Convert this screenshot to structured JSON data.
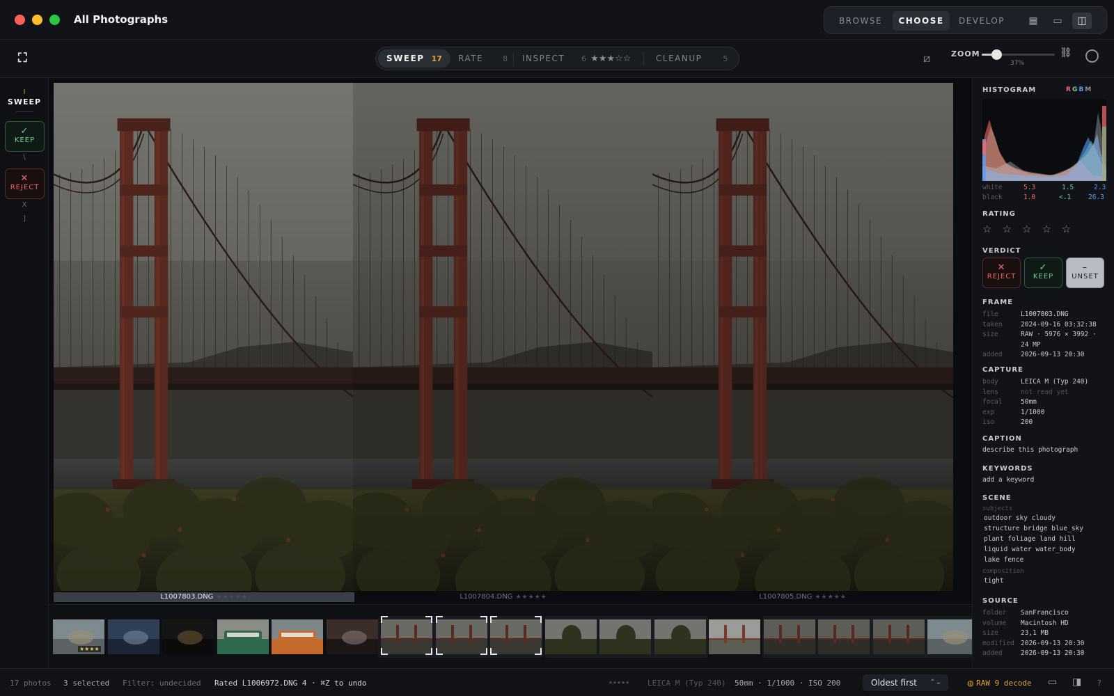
{
  "window": {
    "title": "All Photographs"
  },
  "modes": [
    {
      "label": "BROWSE",
      "active": false
    },
    {
      "label": "CHOOSE",
      "active": true
    },
    {
      "label": "DEVELOP",
      "active": false
    }
  ],
  "view_buttons": [
    {
      "icon": "grid-view-icon",
      "active": false
    },
    {
      "icon": "single-view-icon",
      "active": false
    },
    {
      "icon": "split-view-icon",
      "active": true
    }
  ],
  "stages": [
    {
      "label": "SWEEP",
      "count": "17",
      "active": true
    },
    {
      "label": "RATE",
      "count": "8",
      "active": false
    },
    {
      "label": "INSPECT",
      "count": "6",
      "stars": "★★★☆☆",
      "active": false
    },
    {
      "label": "CLEANUP",
      "count": "5",
      "active": false
    }
  ],
  "zoom": {
    "label": "ZOOM",
    "value": "37%",
    "fraction": 0.2
  },
  "left_rail": {
    "stage_key": "I",
    "stage_title": "SWEEP",
    "keep_label": "KEEP",
    "keep_key": "\\",
    "reject_label": "REJECT",
    "reject_key": "X",
    "next_key": "]"
  },
  "frames": [
    {
      "filename": "L1007803.DNG",
      "stars": "★★★★★",
      "selected": true
    },
    {
      "filename": "L1007804.DNG",
      "stars": "★★★★★",
      "selected": false
    },
    {
      "filename": "L1007805.DNG",
      "stars": "★★★★★",
      "selected": false
    }
  ],
  "filmstrip": {
    "thumbs": [
      {
        "scene": "beach",
        "stars": "★★★★"
      },
      {
        "scene": "street"
      },
      {
        "scene": "dark"
      },
      {
        "scene": "tram-green"
      },
      {
        "scene": "tram-orange"
      },
      {
        "scene": "interior"
      },
      {
        "scene": "bridge",
        "bracket": true
      },
      {
        "scene": "bridge",
        "bracket": true
      },
      {
        "scene": "bridge",
        "bracket": true
      },
      {
        "scene": "cypress"
      },
      {
        "scene": "cypress"
      },
      {
        "scene": "cypress"
      },
      {
        "scene": "bridge-far"
      },
      {
        "scene": "bridge-dark"
      },
      {
        "scene": "bridge-dark"
      },
      {
        "scene": "bridge-dark"
      },
      {
        "scene": "beach"
      }
    ]
  },
  "sidebar": {
    "histogram": {
      "title": "HISTOGRAM",
      "channels": {
        "r": "R",
        "g": "G",
        "b": "B",
        "m": "M"
      },
      "white_label": "white",
      "white": [
        "5.3",
        "1.5",
        "2.3"
      ],
      "black_label": "black",
      "black": [
        "1.0",
        "<.1",
        "26.3"
      ]
    },
    "rating": {
      "title": "RATING",
      "stars": "☆☆☆☆☆"
    },
    "verdict": {
      "title": "VERDICT",
      "reject": "REJECT",
      "keep": "KEEP",
      "unset": "UNSET"
    },
    "frame": {
      "title": "FRAME",
      "rows": [
        {
          "k": "file",
          "v": "L1007803.DNG"
        },
        {
          "k": "taken",
          "v": "2024-09-16 03:32:38"
        },
        {
          "k": "size",
          "v": "RAW · 5976 × 3992 ·"
        },
        {
          "k": "",
          "v": "24 MP"
        },
        {
          "k": "added",
          "v": "2026-09-13 20:30"
        }
      ]
    },
    "capture": {
      "title": "CAPTURE",
      "rows": [
        {
          "k": "body",
          "v": "LEICA M (Typ 240)"
        },
        {
          "k": "lens",
          "v": "not read yet",
          "muted": true
        },
        {
          "k": "focal",
          "v": "50mm"
        },
        {
          "k": "exp",
          "v": "1/1000"
        },
        {
          "k": "iso",
          "v": "200"
        }
      ]
    },
    "caption": {
      "title": "CAPTION",
      "placeholder": "describe this photograph"
    },
    "keywords": {
      "title": "KEYWORDS",
      "placeholder": "add a keyword"
    },
    "scene": {
      "title": "SCENE",
      "subjects_label": "subjects",
      "subjects": [
        "outdoor sky cloudy",
        "structure bridge blue_sky",
        "plant foliage land hill",
        "liquid water water_body",
        "lake fence"
      ],
      "composition_label": "composition",
      "composition": "tight"
    },
    "source": {
      "title": "SOURCE",
      "rows": [
        {
          "k": "folder",
          "v": "SanFrancisco"
        },
        {
          "k": "volume",
          "v": "Macintosh HD"
        },
        {
          "k": "size",
          "v": "23,1 MB"
        },
        {
          "k": "modified",
          "v": "2026-09-13 20:30"
        },
        {
          "k": "added",
          "v": "2026-09-13 20:30"
        }
      ]
    }
  },
  "status": {
    "photos": "17 photos",
    "selected": "3 selected",
    "filter": "Filter: undecided",
    "message": "Rated L1006972.DNG 4 · ⌘Z to undo",
    "stars": "★★★★★",
    "exif_body": "LEICA M (Typ 240)",
    "exif_rest": "50mm · 1/1000 · ISO 200",
    "sort": "Oldest first",
    "decode": "RAW 9 decode",
    "help": "?"
  },
  "colors": {
    "accent": "#e3a23a",
    "keep": "#6fcf97",
    "reject": "#f06a6a",
    "blue": "#5b9cf5"
  }
}
